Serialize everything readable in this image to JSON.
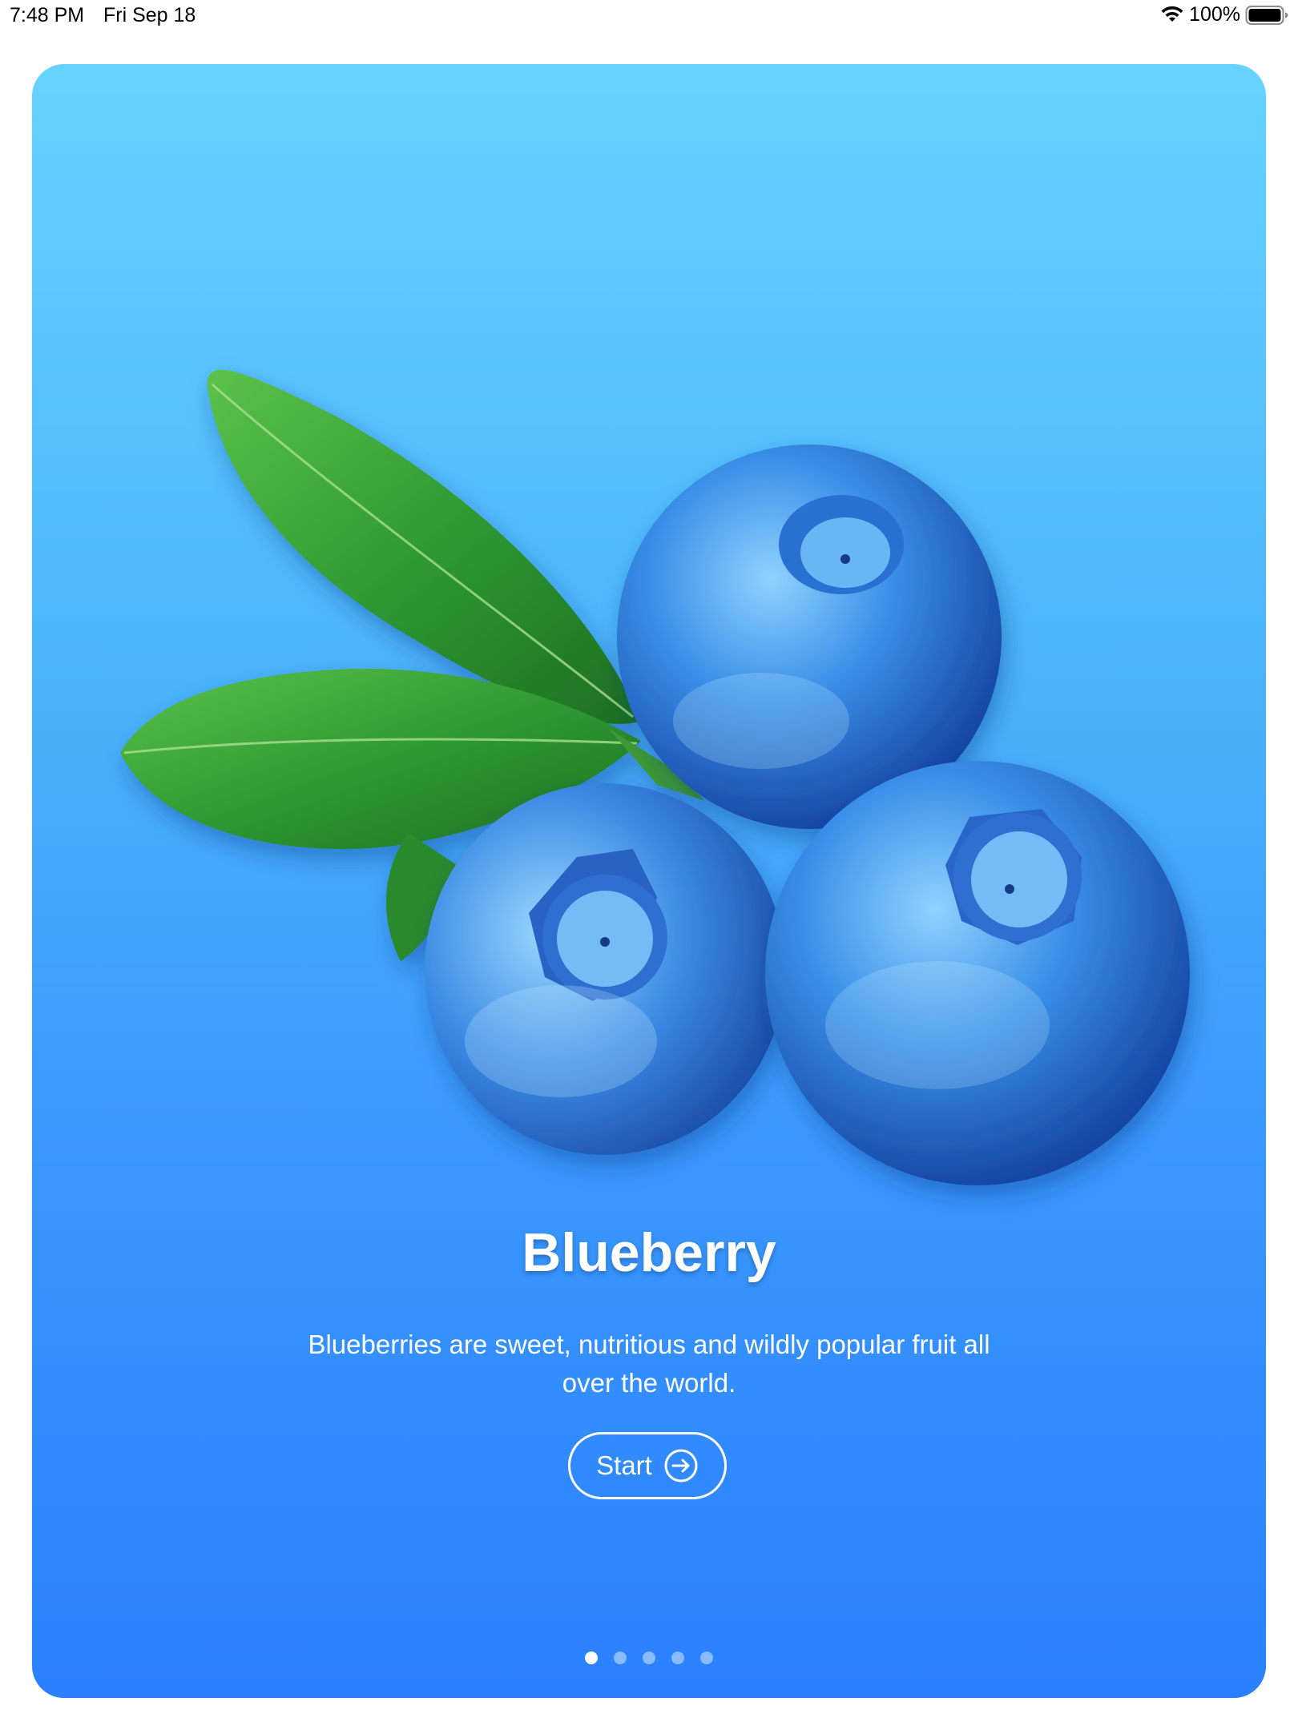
{
  "status_bar": {
    "time": "7:48 PM",
    "date": "Fri Sep 18",
    "battery_percent": "100%",
    "icons": [
      "wifi-icon",
      "battery-icon"
    ]
  },
  "slide": {
    "title": "Blueberry",
    "description": "Blueberries are sweet, nutritious and wildly popular fruit all over the world.",
    "start_label": "Start",
    "image": "blueberries-with-leaves",
    "gradient": [
      "#66d3ff",
      "#2a80ff"
    ]
  },
  "pager": {
    "total": 5,
    "current": 1
  }
}
